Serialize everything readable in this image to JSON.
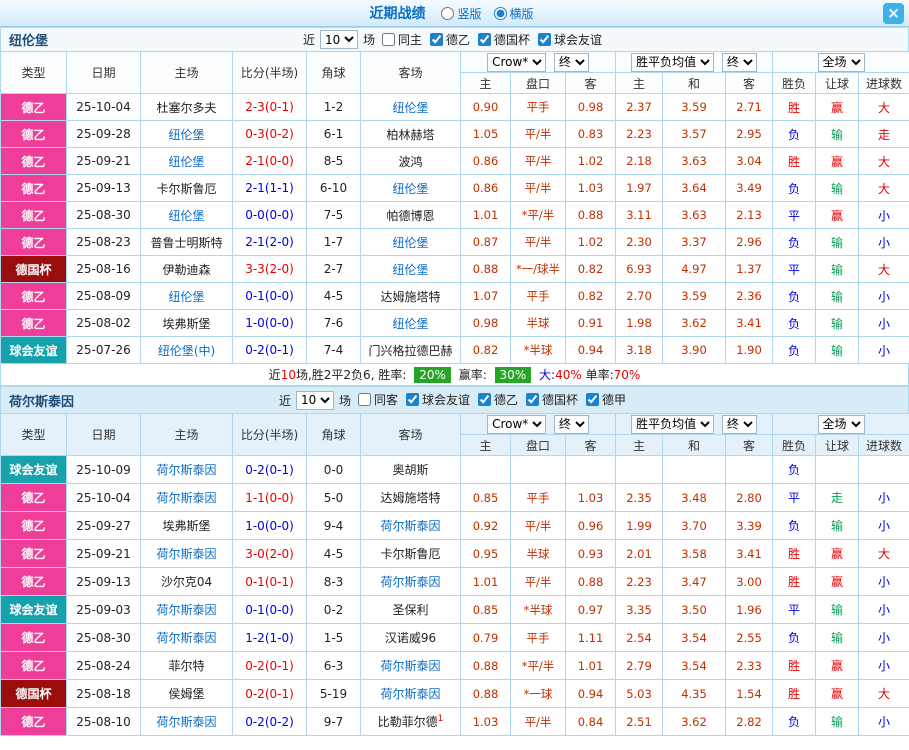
{
  "titlebar": {
    "title": "近期战绩",
    "radios": [
      {
        "label": "竖版",
        "checked": false
      },
      {
        "label": "横版",
        "checked": true
      }
    ],
    "close": "×"
  },
  "table": {
    "cols": [
      "类型",
      "日期",
      "主场",
      "比分(半场)",
      "角球",
      "客场"
    ],
    "odds_select": "Crow*",
    "final_select": "终",
    "avg_select": "胜平负均值",
    "scope_select": "全场",
    "odds_sub": [
      "主",
      "盘口",
      "客"
    ],
    "avg_sub": [
      "主",
      "和",
      "客"
    ],
    "result_sub": [
      "胜负",
      "让球",
      "进球数"
    ]
  },
  "colors": {
    "league2": "#ee3e99",
    "cup": "#9b0d0d",
    "friendly": "#16a2aa",
    "win": "#e60000",
    "lose": "#0000dd",
    "push": "#089b57",
    "badge": "#27a527"
  },
  "sections": [
    {
      "team": "纽伦堡",
      "filter": {
        "near": "近",
        "count": "10",
        "unit": "场",
        "checkboxes": [
          {
            "label": "同主",
            "checked": false
          },
          {
            "label": "德乙",
            "checked": true
          },
          {
            "label": "德国杯",
            "checked": true
          },
          {
            "label": "球会友谊",
            "checked": true
          }
        ]
      },
      "rows": [
        {
          "type": "德乙",
          "tc": "l2",
          "date": "25-10-04",
          "home": "杜塞尔多夫",
          "hf": 0,
          "score": "2-3(0-1)",
          "sc": "r",
          "corner": "1-2",
          "away": "纽伦堡",
          "af": 1,
          "o": [
            "0.90",
            "平手",
            "0.98"
          ],
          "w": [
            "2.37",
            "3.59",
            "2.71"
          ],
          "r": [
            [
              "胜",
              "r"
            ],
            [
              "赢",
              "r"
            ],
            [
              "大",
              "r"
            ]
          ]
        },
        {
          "type": "德乙",
          "tc": "l2",
          "date": "25-09-28",
          "home": "纽伦堡",
          "hf": 1,
          "score": "0-3(0-2)",
          "sc": "r",
          "corner": "6-1",
          "away": "柏林赫塔",
          "af": 0,
          "o": [
            "1.05",
            "平/半",
            "0.83"
          ],
          "w": [
            "2.23",
            "3.57",
            "2.95"
          ],
          "r": [
            [
              "负",
              "b"
            ],
            [
              "输",
              "g"
            ],
            [
              "走",
              "r"
            ]
          ]
        },
        {
          "type": "德乙",
          "tc": "l2",
          "date": "25-09-21",
          "home": "纽伦堡",
          "hf": 1,
          "score": "2-1(0-0)",
          "sc": "r",
          "corner": "8-5",
          "away": "波鸿",
          "af": 0,
          "o": [
            "0.86",
            "平/半",
            "1.02"
          ],
          "w": [
            "2.18",
            "3.63",
            "3.04"
          ],
          "r": [
            [
              "胜",
              "r"
            ],
            [
              "赢",
              "r"
            ],
            [
              "大",
              "r"
            ]
          ]
        },
        {
          "type": "德乙",
          "tc": "l2",
          "date": "25-09-13",
          "home": "卡尔斯鲁厄",
          "hf": 0,
          "score": "2-1(1-1)",
          "sc": "b",
          "corner": "6-10",
          "away": "纽伦堡",
          "af": 1,
          "o": [
            "0.86",
            "平/半",
            "1.03"
          ],
          "w": [
            "1.97",
            "3.64",
            "3.49"
          ],
          "r": [
            [
              "负",
              "b"
            ],
            [
              "输",
              "g"
            ],
            [
              "大",
              "r"
            ]
          ]
        },
        {
          "type": "德乙",
          "tc": "l2",
          "date": "25-08-30",
          "home": "纽伦堡",
          "hf": 1,
          "score": "0-0(0-0)",
          "sc": "b",
          "corner": "7-5",
          "away": "帕德博恩",
          "af": 0,
          "o": [
            "1.01",
            "*平/半",
            "0.88"
          ],
          "w": [
            "3.11",
            "3.63",
            "2.13"
          ],
          "r": [
            [
              "平",
              "b"
            ],
            [
              "赢",
              "r"
            ],
            [
              "小",
              "b"
            ]
          ]
        },
        {
          "type": "德乙",
          "tc": "l2",
          "date": "25-08-23",
          "home": "普鲁士明斯特",
          "hf": 0,
          "score": "2-1(2-0)",
          "sc": "b",
          "corner": "1-7",
          "away": "纽伦堡",
          "af": 1,
          "o": [
            "0.87",
            "平/半",
            "1.02"
          ],
          "w": [
            "2.30",
            "3.37",
            "2.96"
          ],
          "r": [
            [
              "负",
              "b"
            ],
            [
              "输",
              "g"
            ],
            [
              "小",
              "b"
            ]
          ]
        },
        {
          "type": "德国杯",
          "tc": "cup",
          "date": "25-08-16",
          "home": "伊勒迪森",
          "hf": 0,
          "score": "3-3(2-0)",
          "sc": "r",
          "corner": "2-7",
          "away": "纽伦堡",
          "af": 1,
          "o": [
            "0.88",
            "*一/球半",
            "0.82"
          ],
          "w": [
            "6.93",
            "4.97",
            "1.37"
          ],
          "r": [
            [
              "平",
              "b"
            ],
            [
              "输",
              "g"
            ],
            [
              "大",
              "r"
            ]
          ]
        },
        {
          "type": "德乙",
          "tc": "l2",
          "date": "25-08-09",
          "home": "纽伦堡",
          "hf": 1,
          "score": "0-1(0-0)",
          "sc": "b",
          "corner": "4-5",
          "away": "达姆施塔特",
          "af": 0,
          "o": [
            "1.07",
            "平手",
            "0.82"
          ],
          "w": [
            "2.70",
            "3.59",
            "2.36"
          ],
          "r": [
            [
              "负",
              "b"
            ],
            [
              "输",
              "g"
            ],
            [
              "小",
              "b"
            ]
          ]
        },
        {
          "type": "德乙",
          "tc": "l2",
          "date": "25-08-02",
          "home": "埃弗斯堡",
          "hf": 0,
          "score": "1-0(0-0)",
          "sc": "b",
          "corner": "7-6",
          "away": "纽伦堡",
          "af": 1,
          "o": [
            "0.98",
            "半球",
            "0.91"
          ],
          "w": [
            "1.98",
            "3.62",
            "3.41"
          ],
          "r": [
            [
              "负",
              "b"
            ],
            [
              "输",
              "g"
            ],
            [
              "小",
              "b"
            ]
          ]
        },
        {
          "type": "球会友谊",
          "tc": "fr",
          "date": "25-07-26",
          "home": "纽伦堡(中)",
          "hf": 1,
          "score": "0-2(0-1)",
          "sc": "b",
          "corner": "7-4",
          "away": "门兴格拉德巴赫",
          "af": 0,
          "o": [
            "0.82",
            "*半球",
            "0.94"
          ],
          "w": [
            "3.18",
            "3.90",
            "1.90"
          ],
          "r": [
            [
              "负",
              "b"
            ],
            [
              "输",
              "g"
            ],
            [
              "小",
              "b"
            ]
          ]
        }
      ]
    },
    {
      "team": "荷尔斯泰因",
      "filter": {
        "near": "近",
        "count": "10",
        "unit": "场",
        "checkboxes": [
          {
            "label": "同客",
            "checked": false
          },
          {
            "label": "球会友谊",
            "checked": true
          },
          {
            "label": "德乙",
            "checked": true
          },
          {
            "label": "德国杯",
            "checked": true
          },
          {
            "label": "德甲",
            "checked": true
          }
        ]
      },
      "rows": [
        {
          "type": "球会友谊",
          "tc": "fr",
          "date": "25-10-09",
          "home": "荷尔斯泰因",
          "hf": 1,
          "score": "0-2(0-1)",
          "sc": "b",
          "corner": "0-0",
          "away": "奥胡斯",
          "af": 0,
          "o": [
            "",
            "",
            ""
          ],
          "w": [
            "",
            "",
            ""
          ],
          "r": [
            [
              "负",
              "b"
            ],
            [
              "",
              ""
            ],
            [
              "",
              ""
            ]
          ]
        },
        {
          "type": "德乙",
          "tc": "l2",
          "date": "25-10-04",
          "home": "荷尔斯泰因",
          "hf": 1,
          "score": "1-1(0-0)",
          "sc": "r",
          "corner": "5-0",
          "away": "达姆施塔特",
          "af": 0,
          "o": [
            "0.85",
            "平手",
            "1.03"
          ],
          "w": [
            "2.35",
            "3.48",
            "2.80"
          ],
          "r": [
            [
              "平",
              "b"
            ],
            [
              "走",
              "g"
            ],
            [
              "小",
              "b"
            ]
          ]
        },
        {
          "type": "德乙",
          "tc": "l2",
          "date": "25-09-27",
          "home": "埃弗斯堡",
          "hf": 0,
          "score": "1-0(0-0)",
          "sc": "b",
          "corner": "9-4",
          "away": "荷尔斯泰因",
          "af": 1,
          "o": [
            "0.92",
            "平/半",
            "0.96"
          ],
          "w": [
            "1.99",
            "3.70",
            "3.39"
          ],
          "r": [
            [
              "负",
              "b"
            ],
            [
              "输",
              "g"
            ],
            [
              "小",
              "b"
            ]
          ]
        },
        {
          "type": "德乙",
          "tc": "l2",
          "date": "25-09-21",
          "home": "荷尔斯泰因",
          "hf": 1,
          "score": "3-0(2-0)",
          "sc": "r",
          "corner": "4-5",
          "away": "卡尔斯鲁厄",
          "af": 0,
          "o": [
            "0.95",
            "半球",
            "0.93"
          ],
          "w": [
            "2.01",
            "3.58",
            "3.41"
          ],
          "r": [
            [
              "胜",
              "r"
            ],
            [
              "赢",
              "r"
            ],
            [
              "大",
              "r"
            ]
          ]
        },
        {
          "type": "德乙",
          "tc": "l2",
          "date": "25-09-13",
          "home": "沙尔克04",
          "hf": 0,
          "score": "0-1(0-1)",
          "sc": "r",
          "corner": "8-3",
          "away": "荷尔斯泰因",
          "af": 1,
          "o": [
            "1.01",
            "平/半",
            "0.88"
          ],
          "w": [
            "2.23",
            "3.47",
            "3.00"
          ],
          "r": [
            [
              "胜",
              "r"
            ],
            [
              "赢",
              "r"
            ],
            [
              "小",
              "b"
            ]
          ]
        },
        {
          "type": "球会友谊",
          "tc": "fr",
          "date": "25-09-03",
          "home": "荷尔斯泰因",
          "hf": 1,
          "score": "0-1(0-0)",
          "sc": "b",
          "corner": "0-2",
          "away": "圣保利",
          "af": 0,
          "o": [
            "0.85",
            "*半球",
            "0.97"
          ],
          "w": [
            "3.35",
            "3.50",
            "1.96"
          ],
          "r": [
            [
              "平",
              "b"
            ],
            [
              "输",
              "g"
            ],
            [
              "小",
              "b"
            ]
          ]
        },
        {
          "type": "德乙",
          "tc": "l2",
          "date": "25-08-30",
          "home": "荷尔斯泰因",
          "hf": 1,
          "score": "1-2(1-0)",
          "sc": "b",
          "corner": "1-5",
          "away": "汉诺威96",
          "af": 0,
          "o": [
            "0.79",
            "平手",
            "1.11"
          ],
          "w": [
            "2.54",
            "3.54",
            "2.55"
          ],
          "r": [
            [
              "负",
              "b"
            ],
            [
              "输",
              "g"
            ],
            [
              "小",
              "b"
            ]
          ]
        },
        {
          "type": "德乙",
          "tc": "l2",
          "date": "25-08-24",
          "home": "菲尔特",
          "hf": 0,
          "score": "0-2(0-1)",
          "sc": "r",
          "corner": "6-3",
          "away": "荷尔斯泰因",
          "af": 1,
          "o": [
            "0.88",
            "*平/半",
            "1.01"
          ],
          "w": [
            "2.79",
            "3.54",
            "2.33"
          ],
          "r": [
            [
              "胜",
              "r"
            ],
            [
              "赢",
              "r"
            ],
            [
              "小",
              "b"
            ]
          ]
        },
        {
          "type": "德国杯",
          "tc": "cup",
          "date": "25-08-18",
          "home": "侯姆堡",
          "hf": 0,
          "score": "0-2(0-1)",
          "sc": "r",
          "corner": "5-19",
          "away": "荷尔斯泰因",
          "af": 1,
          "o": [
            "0.88",
            "*一球",
            "0.94"
          ],
          "w": [
            "5.03",
            "4.35",
            "1.54"
          ],
          "r": [
            [
              "胜",
              "r"
            ],
            [
              "赢",
              "r"
            ],
            [
              "大",
              "r"
            ]
          ]
        },
        {
          "type": "德乙",
          "tc": "l2",
          "date": "25-08-10",
          "home": "荷尔斯泰因",
          "hf": 1,
          "score": "0-2(0-2)",
          "sc": "b",
          "corner": "9-7",
          "away": "比勒菲尔德",
          "asup": "1",
          "af": 0,
          "o": [
            "1.03",
            "平/半",
            "0.84"
          ],
          "w": [
            "2.51",
            "3.62",
            "2.82"
          ],
          "r": [
            [
              "负",
              "b"
            ],
            [
              "输",
              "g"
            ],
            [
              "小",
              "b"
            ]
          ]
        }
      ]
    }
  ],
  "summary": {
    "t0": "近",
    "n": "10",
    "t1": "场,胜2平2负6, ",
    "rate_label": "胜率: ",
    "win_rate": "20%",
    "win_label": "赢率: ",
    "handicap_rate": "30%",
    "big_label": "大:",
    "big_rate": "40%",
    "single_label": " 单率:",
    "single_rate": "70%"
  }
}
